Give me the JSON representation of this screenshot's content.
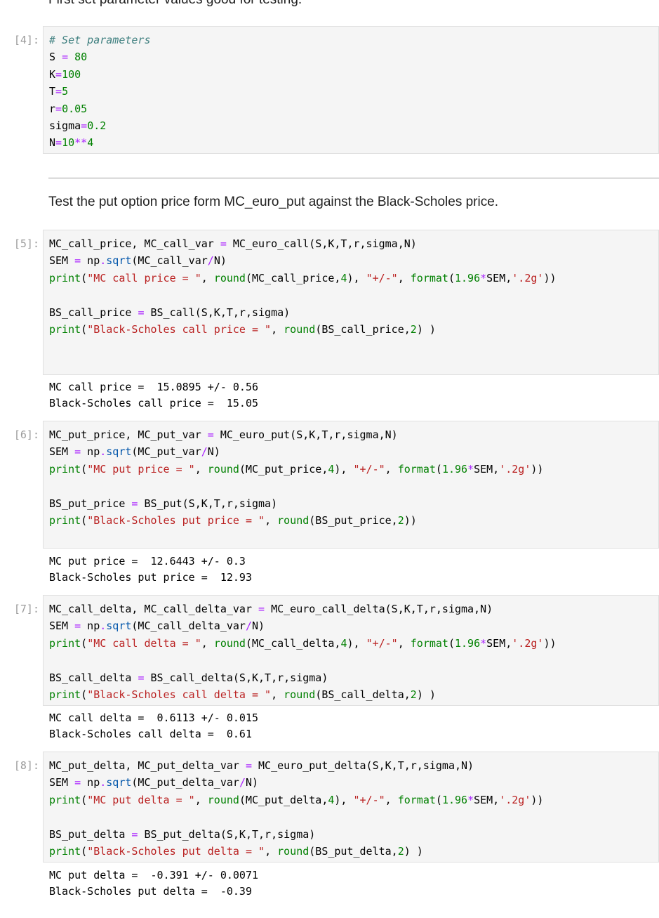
{
  "intro_text": "First set parameter values good for testing.",
  "section_text": "Test the put option price form MC_euro_put against the Black-Scholes price.",
  "cells": [
    {
      "prompt": "[4]:",
      "lines": [
        [
          [
            "cm",
            "# Set parameters"
          ]
        ],
        [
          [
            "tx",
            "S "
          ],
          [
            "op",
            "="
          ],
          [
            "tx",
            " "
          ],
          [
            "nu",
            "80"
          ]
        ],
        [
          [
            "tx",
            "K"
          ],
          [
            "op",
            "="
          ],
          [
            "nu",
            "100"
          ]
        ],
        [
          [
            "tx",
            "T"
          ],
          [
            "op",
            "="
          ],
          [
            "nu",
            "5"
          ]
        ],
        [
          [
            "tx",
            "r"
          ],
          [
            "op",
            "="
          ],
          [
            "nu",
            "0.05"
          ]
        ],
        [
          [
            "tx",
            "sigma"
          ],
          [
            "op",
            "="
          ],
          [
            "nu",
            "0.2"
          ]
        ],
        [
          [
            "tx",
            "N"
          ],
          [
            "op",
            "="
          ],
          [
            "nu",
            "10"
          ],
          [
            "op",
            "**"
          ],
          [
            "nu",
            "4"
          ]
        ]
      ],
      "output": []
    },
    {
      "prompt": "[5]:",
      "lines": [
        [
          [
            "tx",
            "MC_call_price, MC_call_var "
          ],
          [
            "op",
            "="
          ],
          [
            "tx",
            " MC_euro_call(S,K,T,r,sigma,N)"
          ]
        ],
        [
          [
            "tx",
            "SEM "
          ],
          [
            "op",
            "="
          ],
          [
            "tx",
            " np"
          ],
          [
            "op",
            "."
          ],
          [
            "at",
            "sqrt"
          ],
          [
            "tx",
            "(MC_call_var"
          ],
          [
            "op",
            "/"
          ],
          [
            "tx",
            "N)"
          ]
        ],
        [
          [
            "kw",
            "print"
          ],
          [
            "tx",
            "("
          ],
          [
            "st",
            "\"MC call price = \""
          ],
          [
            "tx",
            ", "
          ],
          [
            "kw",
            "round"
          ],
          [
            "tx",
            "(MC_call_price,"
          ],
          [
            "nu",
            "4"
          ],
          [
            "tx",
            "), "
          ],
          [
            "st",
            "\"+/-\""
          ],
          [
            "tx",
            ", "
          ],
          [
            "kw",
            "format"
          ],
          [
            "tx",
            "("
          ],
          [
            "nu",
            "1.96"
          ],
          [
            "op",
            "*"
          ],
          [
            "tx",
            "SEM,"
          ],
          [
            "st",
            "'.2g'"
          ],
          [
            "tx",
            "))"
          ]
        ],
        [
          [
            "tx",
            ""
          ]
        ],
        [
          [
            "tx",
            "BS_call_price "
          ],
          [
            "op",
            "="
          ],
          [
            "tx",
            " BS_call(S,K,T,r,sigma)"
          ]
        ],
        [
          [
            "kw",
            "print"
          ],
          [
            "tx",
            "("
          ],
          [
            "st",
            "\"Black-Scholes call price = \""
          ],
          [
            "tx",
            ", "
          ],
          [
            "kw",
            "round"
          ],
          [
            "tx",
            "(BS_call_price,"
          ],
          [
            "nu",
            "2"
          ],
          [
            "tx",
            ") )"
          ]
        ],
        [
          [
            "tx",
            ""
          ]
        ],
        [
          [
            "tx",
            ""
          ]
        ]
      ],
      "output": [
        "MC call price =  15.0895 +/- 0.56",
        "Black-Scholes call price =  15.05"
      ]
    },
    {
      "prompt": "[6]:",
      "lines": [
        [
          [
            "tx",
            "MC_put_price, MC_put_var "
          ],
          [
            "op",
            "="
          ],
          [
            "tx",
            " MC_euro_put(S,K,T,r,sigma,N)"
          ]
        ],
        [
          [
            "tx",
            "SEM "
          ],
          [
            "op",
            "="
          ],
          [
            "tx",
            " np"
          ],
          [
            "op",
            "."
          ],
          [
            "at",
            "sqrt"
          ],
          [
            "tx",
            "(MC_put_var"
          ],
          [
            "op",
            "/"
          ],
          [
            "tx",
            "N)"
          ]
        ],
        [
          [
            "kw",
            "print"
          ],
          [
            "tx",
            "("
          ],
          [
            "st",
            "\"MC put price = \""
          ],
          [
            "tx",
            ", "
          ],
          [
            "kw",
            "round"
          ],
          [
            "tx",
            "(MC_put_price,"
          ],
          [
            "nu",
            "4"
          ],
          [
            "tx",
            "), "
          ],
          [
            "st",
            "\"+/-\""
          ],
          [
            "tx",
            ", "
          ],
          [
            "kw",
            "format"
          ],
          [
            "tx",
            "("
          ],
          [
            "nu",
            "1.96"
          ],
          [
            "op",
            "*"
          ],
          [
            "tx",
            "SEM,"
          ],
          [
            "st",
            "'.2g'"
          ],
          [
            "tx",
            "))"
          ]
        ],
        [
          [
            "tx",
            ""
          ]
        ],
        [
          [
            "tx",
            "BS_put_price "
          ],
          [
            "op",
            "="
          ],
          [
            "tx",
            " BS_put(S,K,T,r,sigma)"
          ]
        ],
        [
          [
            "kw",
            "print"
          ],
          [
            "tx",
            "("
          ],
          [
            "st",
            "\"Black-Scholes put price = \""
          ],
          [
            "tx",
            ", "
          ],
          [
            "kw",
            "round"
          ],
          [
            "tx",
            "(BS_put_price,"
          ],
          [
            "nu",
            "2"
          ],
          [
            "tx",
            "))"
          ]
        ],
        [
          [
            "tx",
            ""
          ]
        ]
      ],
      "output": [
        "MC put price =  12.6443 +/- 0.3",
        "Black-Scholes put price =  12.93"
      ]
    },
    {
      "prompt": "[7]:",
      "lines": [
        [
          [
            "tx",
            "MC_call_delta, MC_call_delta_var "
          ],
          [
            "op",
            "="
          ],
          [
            "tx",
            " MC_euro_call_delta(S,K,T,r,sigma,N)"
          ]
        ],
        [
          [
            "tx",
            "SEM "
          ],
          [
            "op",
            "="
          ],
          [
            "tx",
            " np"
          ],
          [
            "op",
            "."
          ],
          [
            "at",
            "sqrt"
          ],
          [
            "tx",
            "(MC_call_delta_var"
          ],
          [
            "op",
            "/"
          ],
          [
            "tx",
            "N)"
          ]
        ],
        [
          [
            "kw",
            "print"
          ],
          [
            "tx",
            "("
          ],
          [
            "st",
            "\"MC call delta = \""
          ],
          [
            "tx",
            ", "
          ],
          [
            "kw",
            "round"
          ],
          [
            "tx",
            "(MC_call_delta,"
          ],
          [
            "nu",
            "4"
          ],
          [
            "tx",
            "), "
          ],
          [
            "st",
            "\"+/-\""
          ],
          [
            "tx",
            ", "
          ],
          [
            "kw",
            "format"
          ],
          [
            "tx",
            "("
          ],
          [
            "nu",
            "1.96"
          ],
          [
            "op",
            "*"
          ],
          [
            "tx",
            "SEM,"
          ],
          [
            "st",
            "'.2g'"
          ],
          [
            "tx",
            "))"
          ]
        ],
        [
          [
            "tx",
            ""
          ]
        ],
        [
          [
            "tx",
            "BS_call_delta "
          ],
          [
            "op",
            "="
          ],
          [
            "tx",
            " BS_call_delta(S,K,T,r,sigma)"
          ]
        ],
        [
          [
            "kw",
            "print"
          ],
          [
            "tx",
            "("
          ],
          [
            "st",
            "\"Black-Scholes call delta = \""
          ],
          [
            "tx",
            ", "
          ],
          [
            "kw",
            "round"
          ],
          [
            "tx",
            "(BS_call_delta,"
          ],
          [
            "nu",
            "2"
          ],
          [
            "tx",
            ") )"
          ]
        ]
      ],
      "output": [
        "MC call delta =  0.6113 +/- 0.015",
        "Black-Scholes call delta =  0.61"
      ]
    },
    {
      "prompt": "[8]:",
      "lines": [
        [
          [
            "tx",
            "MC_put_delta, MC_put_delta_var "
          ],
          [
            "op",
            "="
          ],
          [
            "tx",
            " MC_euro_put_delta(S,K,T,r,sigma,N)"
          ]
        ],
        [
          [
            "tx",
            "SEM "
          ],
          [
            "op",
            "="
          ],
          [
            "tx",
            " np"
          ],
          [
            "op",
            "."
          ],
          [
            "at",
            "sqrt"
          ],
          [
            "tx",
            "(MC_put_delta_var"
          ],
          [
            "op",
            "/"
          ],
          [
            "tx",
            "N)"
          ]
        ],
        [
          [
            "kw",
            "print"
          ],
          [
            "tx",
            "("
          ],
          [
            "st",
            "\"MC put delta = \""
          ],
          [
            "tx",
            ", "
          ],
          [
            "kw",
            "round"
          ],
          [
            "tx",
            "(MC_put_delta,"
          ],
          [
            "nu",
            "4"
          ],
          [
            "tx",
            "), "
          ],
          [
            "st",
            "\"+/-\""
          ],
          [
            "tx",
            ", "
          ],
          [
            "kw",
            "format"
          ],
          [
            "tx",
            "("
          ],
          [
            "nu",
            "1.96"
          ],
          [
            "op",
            "*"
          ],
          [
            "tx",
            "SEM,"
          ],
          [
            "st",
            "'.2g'"
          ],
          [
            "tx",
            "))"
          ]
        ],
        [
          [
            "tx",
            ""
          ]
        ],
        [
          [
            "tx",
            "BS_put_delta "
          ],
          [
            "op",
            "="
          ],
          [
            "tx",
            " BS_put_delta(S,K,T,r,sigma)"
          ]
        ],
        [
          [
            "kw",
            "print"
          ],
          [
            "tx",
            "("
          ],
          [
            "st",
            "\"Black-Scholes put delta = \""
          ],
          [
            "tx",
            ", "
          ],
          [
            "kw",
            "round"
          ],
          [
            "tx",
            "(BS_put_delta,"
          ],
          [
            "nu",
            "2"
          ],
          [
            "tx",
            ") )"
          ]
        ]
      ],
      "output": [
        "MC put delta =  -0.391 +/- 0.0071",
        "Black-Scholes put delta =  -0.39"
      ]
    }
  ]
}
